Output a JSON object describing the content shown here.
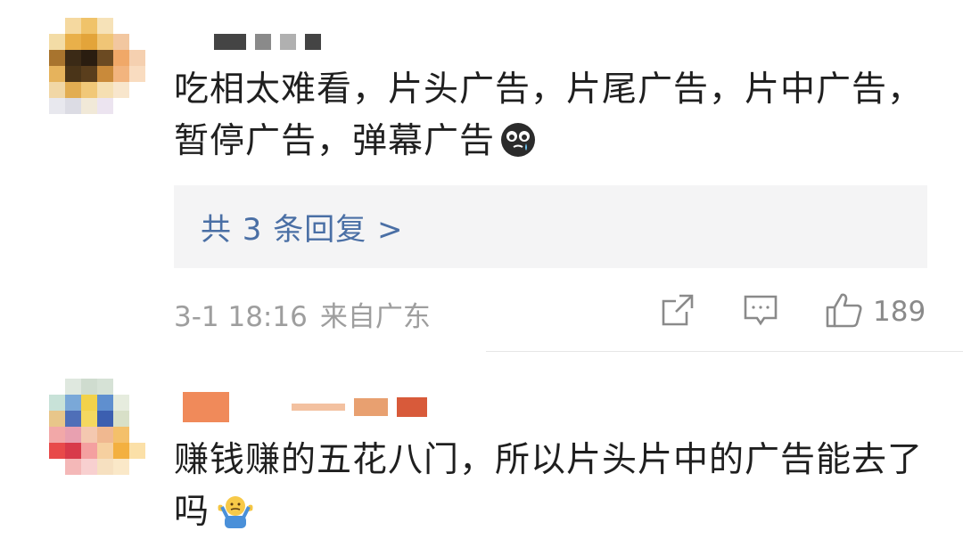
{
  "comments": [
    {
      "text": "吃相太难看，片头广告，片尾广告，片中广告，暂停广告，弹幕广告",
      "emoji": "crying-face-emoji",
      "replies_label": "共 3 条回复 >",
      "timestamp": "3-1 18:16",
      "location": "来自广东",
      "like_count": "189",
      "avatar_colors": [
        [
          "#ffffff",
          "#f5d9a0",
          "#f0c36a",
          "#f6e2b8",
          "#ffffff",
          "#ffffff"
        ],
        [
          "#f3dca6",
          "#e9b04a",
          "#e3a43a",
          "#f0c576",
          "#f2c7a0",
          "#ffffff"
        ],
        [
          "#a8742e",
          "#3b2a16",
          "#2a1d10",
          "#6b4a22",
          "#f0a868",
          "#f5d0b0"
        ],
        [
          "#e6b35c",
          "#4a3418",
          "#5a3e1c",
          "#c98a3a",
          "#f2b47e",
          "#f9dcc0"
        ],
        [
          "#f1d7a6",
          "#e2ad52",
          "#f1c878",
          "#f5dfb2",
          "#f8e6cc",
          "#ffffff"
        ],
        [
          "#e8e8ee",
          "#dcdce4",
          "#f1e9d8",
          "#ece4f0",
          "#ffffff",
          "#ffffff"
        ]
      ],
      "username_colors": [
        "#444444",
        "#8a8a8a",
        "#b0b0b0",
        "#444444"
      ]
    },
    {
      "text": "赚钱赚的五花八门，所以片头片中的广告能去了吗",
      "emoji": "shrugging-person-emoji",
      "avatar_colors": [
        [
          "#ffffff",
          "#dfe8df",
          "#cfdccf",
          "#d6e2d6",
          "#ffffff",
          "#ffffff"
        ],
        [
          "#c8e2d8",
          "#7aa8d8",
          "#f2d24a",
          "#5f8fcf",
          "#e6ecde",
          "#ffffff"
        ],
        [
          "#e8c68a",
          "#4f6fb8",
          "#f4d860",
          "#3c5fb0",
          "#d8e0c8",
          "#ffffff"
        ],
        [
          "#f2a8a8",
          "#e8a0b0",
          "#f4c8b0",
          "#f0b890",
          "#f4c06a",
          "#ffffff"
        ],
        [
          "#e84a4a",
          "#d83a4a",
          "#f4a0a0",
          "#f6d0a0",
          "#f3b040",
          "#fbe0a8"
        ],
        [
          "#ffffff",
          "#f4b8b8",
          "#f8d0d0",
          "#f6e0c0",
          "#fae8c8",
          "#ffffff"
        ]
      ],
      "username_colors": [
        "#f08a5a",
        "#f3c1a0",
        "#e8a070",
        "#d85a3a"
      ]
    }
  ]
}
